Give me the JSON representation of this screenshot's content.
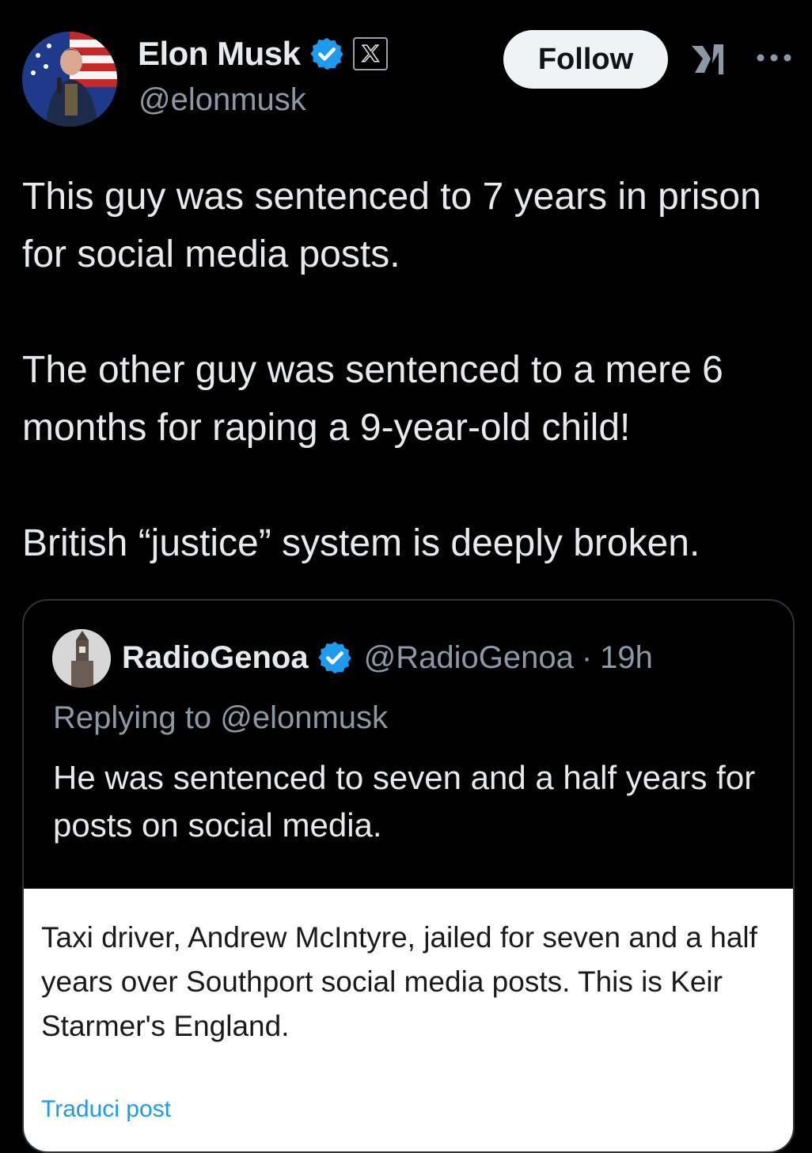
{
  "author": {
    "name": "Elon Musk",
    "handle": "@elonmusk",
    "verified_color": "#1d9bf0"
  },
  "header": {
    "follow_label": "Follow",
    "icons": [
      "verified-badge-icon",
      "x-affiliate-icon",
      "grok-icon",
      "more-icon"
    ]
  },
  "post": {
    "text": "This guy was sentenced to 7 years in prison for social media posts.\n\nThe other guy was sentenced to a mere 6 months for raping a 9-year-old child!\n\nBritish “justice” system is deeply broken."
  },
  "quote": {
    "name": "RadioGenoa",
    "handle": "@RadioGenoa",
    "separator": "·",
    "time": "19h",
    "replying_to": "Replying to @elonmusk",
    "text": "He was sentenced to seven and a half years for posts on social media.",
    "image_text": "Taxi driver, Andrew McIntyre, jailed for seven and a half years over Southport social media posts. This is Keir Starmer's England.",
    "translate_label": "Traduci post"
  },
  "colors": {
    "background": "#000000",
    "text": "#e7e9ea",
    "secondary": "#8b98a5",
    "border": "#2f3336",
    "accent": "#1d9bf0",
    "follow_bg": "#eff3f4"
  }
}
